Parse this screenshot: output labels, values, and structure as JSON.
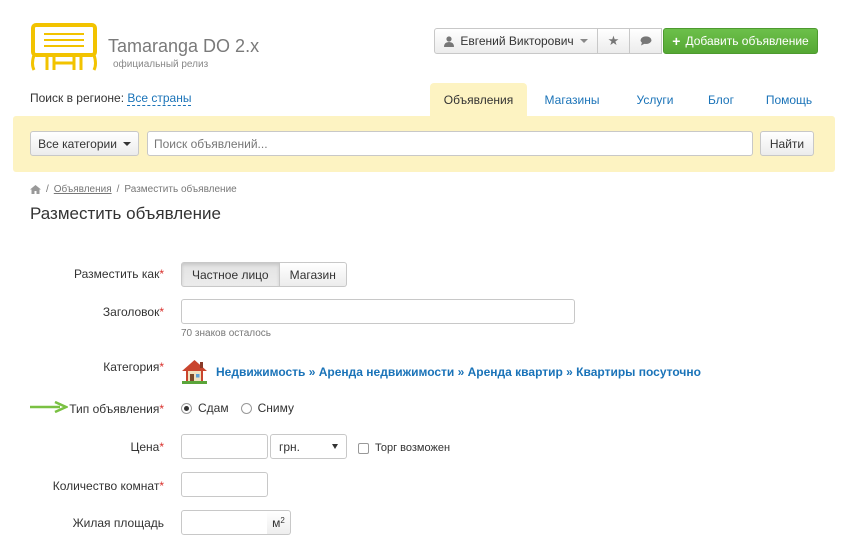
{
  "header": {
    "brand_name": "Tamaranga DO 2.x",
    "brand_subtitle": "официальный релиз",
    "user_name": "Евгений Викторович",
    "add_listing_label": "Добавить объявление",
    "accent_color": "#5cb53b",
    "logo_color": "#f2c300"
  },
  "region": {
    "label": "Поиск в регионе:",
    "value": "Все страны"
  },
  "nav": {
    "tabs": [
      {
        "label": "Объявления",
        "active": true
      },
      {
        "label": "Магазины"
      },
      {
        "label": "Услуги"
      },
      {
        "label": "Блог"
      },
      {
        "label": "Помощь"
      }
    ]
  },
  "search": {
    "categories_label": "Все категории",
    "placeholder": "Поиск объявлений...",
    "button_label": "Найти",
    "bar_color": "#fdf3c2"
  },
  "breadcrumb": {
    "link": "Объявления",
    "current": "Разместить объявление"
  },
  "page_title": "Разместить объявление",
  "form": {
    "post_as": {
      "label": "Разместить как",
      "options": [
        "Частное лицо",
        "Магазин"
      ],
      "selected": "Частное лицо"
    },
    "title": {
      "label": "Заголовок",
      "value": "",
      "hint": "70 знаков осталось"
    },
    "category": {
      "label": "Категория",
      "path": "Недвижимость » Аренда недвижимости » Аренда квартир » Квартиры посуточно",
      "icon": "house-icon"
    },
    "listing_type": {
      "label": "Тип объявления",
      "options": [
        "Сдам",
        "Сниму"
      ],
      "selected": "Сдам"
    },
    "price": {
      "label": "Цена",
      "value": "",
      "currency": "грн.",
      "bargain_label": "Торг возможен",
      "bargain_checked": false
    },
    "rooms": {
      "label": "Количество комнат",
      "value": ""
    },
    "living_area": {
      "label": "Жилая площадь",
      "value": "",
      "unit": "м",
      "unit_sup": "2"
    }
  },
  "annotation": {
    "arrow_color": "#7ac143"
  }
}
